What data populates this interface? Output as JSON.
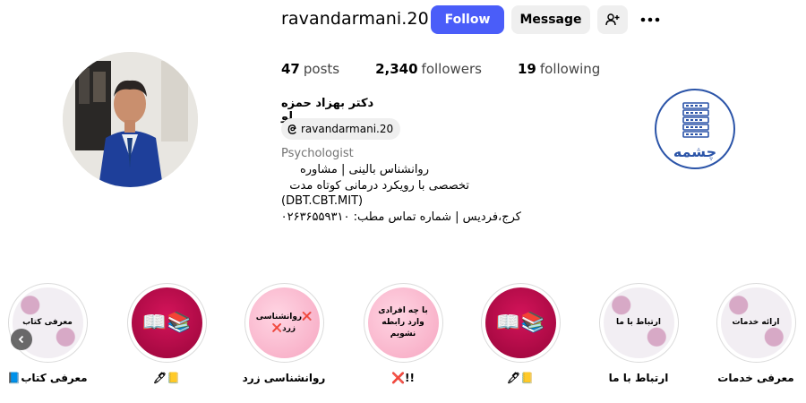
{
  "profile": {
    "username": "ravandarmani.20",
    "follow_label": "Follow",
    "message_label": "Message",
    "posts_count": "47",
    "posts_label": "posts",
    "followers_count": "2,340",
    "followers_label": "followers",
    "following_count": "19",
    "following_label": "following",
    "full_name": "دکتر بهزاد حمزه لو",
    "threads_handle": "ravandarmani.20",
    "category": "Psychologist",
    "bio": [
      "روانشناس بالینی | مشاوره",
      "تخصصی با رویکرد درمانی کوتاه مدت",
      "(DBT.CBT.MIT)",
      "کرج،فردیس | شماره تماس مطب: ۰۲۶۳۶۵۵۹۳۱۰"
    ]
  },
  "logo": {
    "text": "چشمه"
  },
  "highlights": [
    {
      "label": "معرفی کتاب📘",
      "cover_text": "معرفی کتاب"
    },
    {
      "label": "📒🖊",
      "cover_text": "📚📖"
    },
    {
      "label": "روانشناسی زرد",
      "cover_text": "❌روانشناسی زرد❌"
    },
    {
      "label": "!!❌",
      "cover_text": "با چه افرادی وارد رابطه نشویم"
    },
    {
      "label": "📒🖊",
      "cover_text": "📚📖"
    },
    {
      "label": "ارتباط با ما",
      "cover_text": "ارتباط با ما"
    },
    {
      "label": "معرفی خدمات",
      "cover_text": "ارائه خدمات"
    }
  ],
  "icons": {
    "add_user": "person-plus-icon",
    "more": "more-horizontal-icon",
    "threads": "threads-icon",
    "scroll_left": "chevron-left-icon"
  },
  "colors": {
    "follow_bg": "#4a5df9",
    "message_bg": "#efefef",
    "logo": "#2b54a8"
  }
}
